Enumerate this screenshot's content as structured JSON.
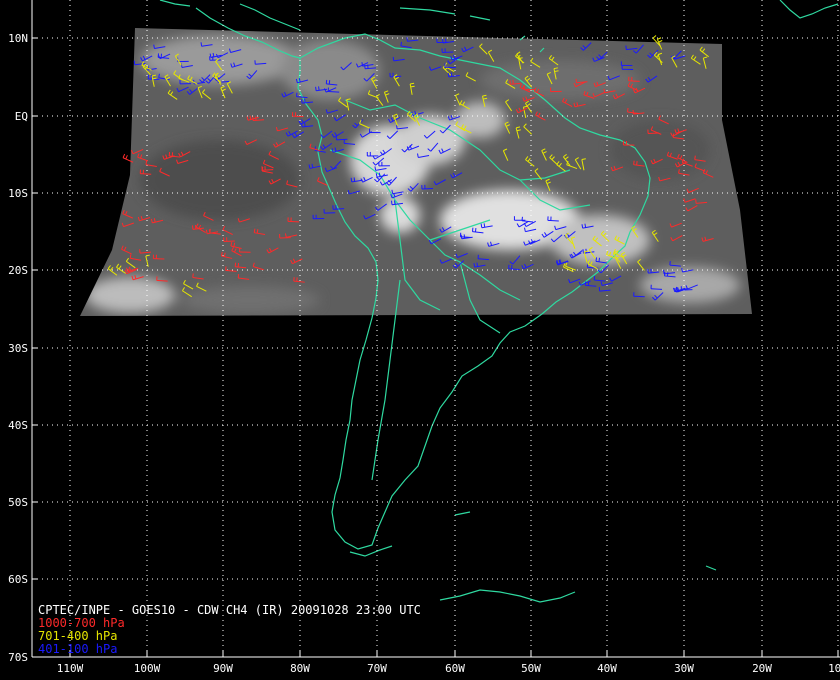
{
  "title": "CPTEC/INPE - GOES10 - CDW CH4 (IR) 20091028 23:00 UTC",
  "legend": [
    {
      "label": "1000-700 hPa",
      "color": "#ff2a2a"
    },
    {
      "label": "701-400 hPa",
      "color": "#e6e600"
    },
    {
      "label": "401-100 hPa",
      "color": "#1a1aff"
    }
  ],
  "lat_labels": [
    "10N",
    "EQ",
    "10S",
    "20S",
    "30S",
    "40S",
    "50S",
    "60S",
    "70S"
  ],
  "lon_labels": [
    "110W",
    "100W",
    "90W",
    "80W",
    "70W",
    "60W",
    "50W",
    "40W",
    "30W",
    "20W",
    "10W"
  ],
  "colors": {
    "background": "#000000",
    "coastline": "#2fd9a0",
    "grid": "#ffffff",
    "low_level": "#ff2a2a",
    "mid_level": "#e6e600",
    "high_level": "#1a1aff"
  }
}
